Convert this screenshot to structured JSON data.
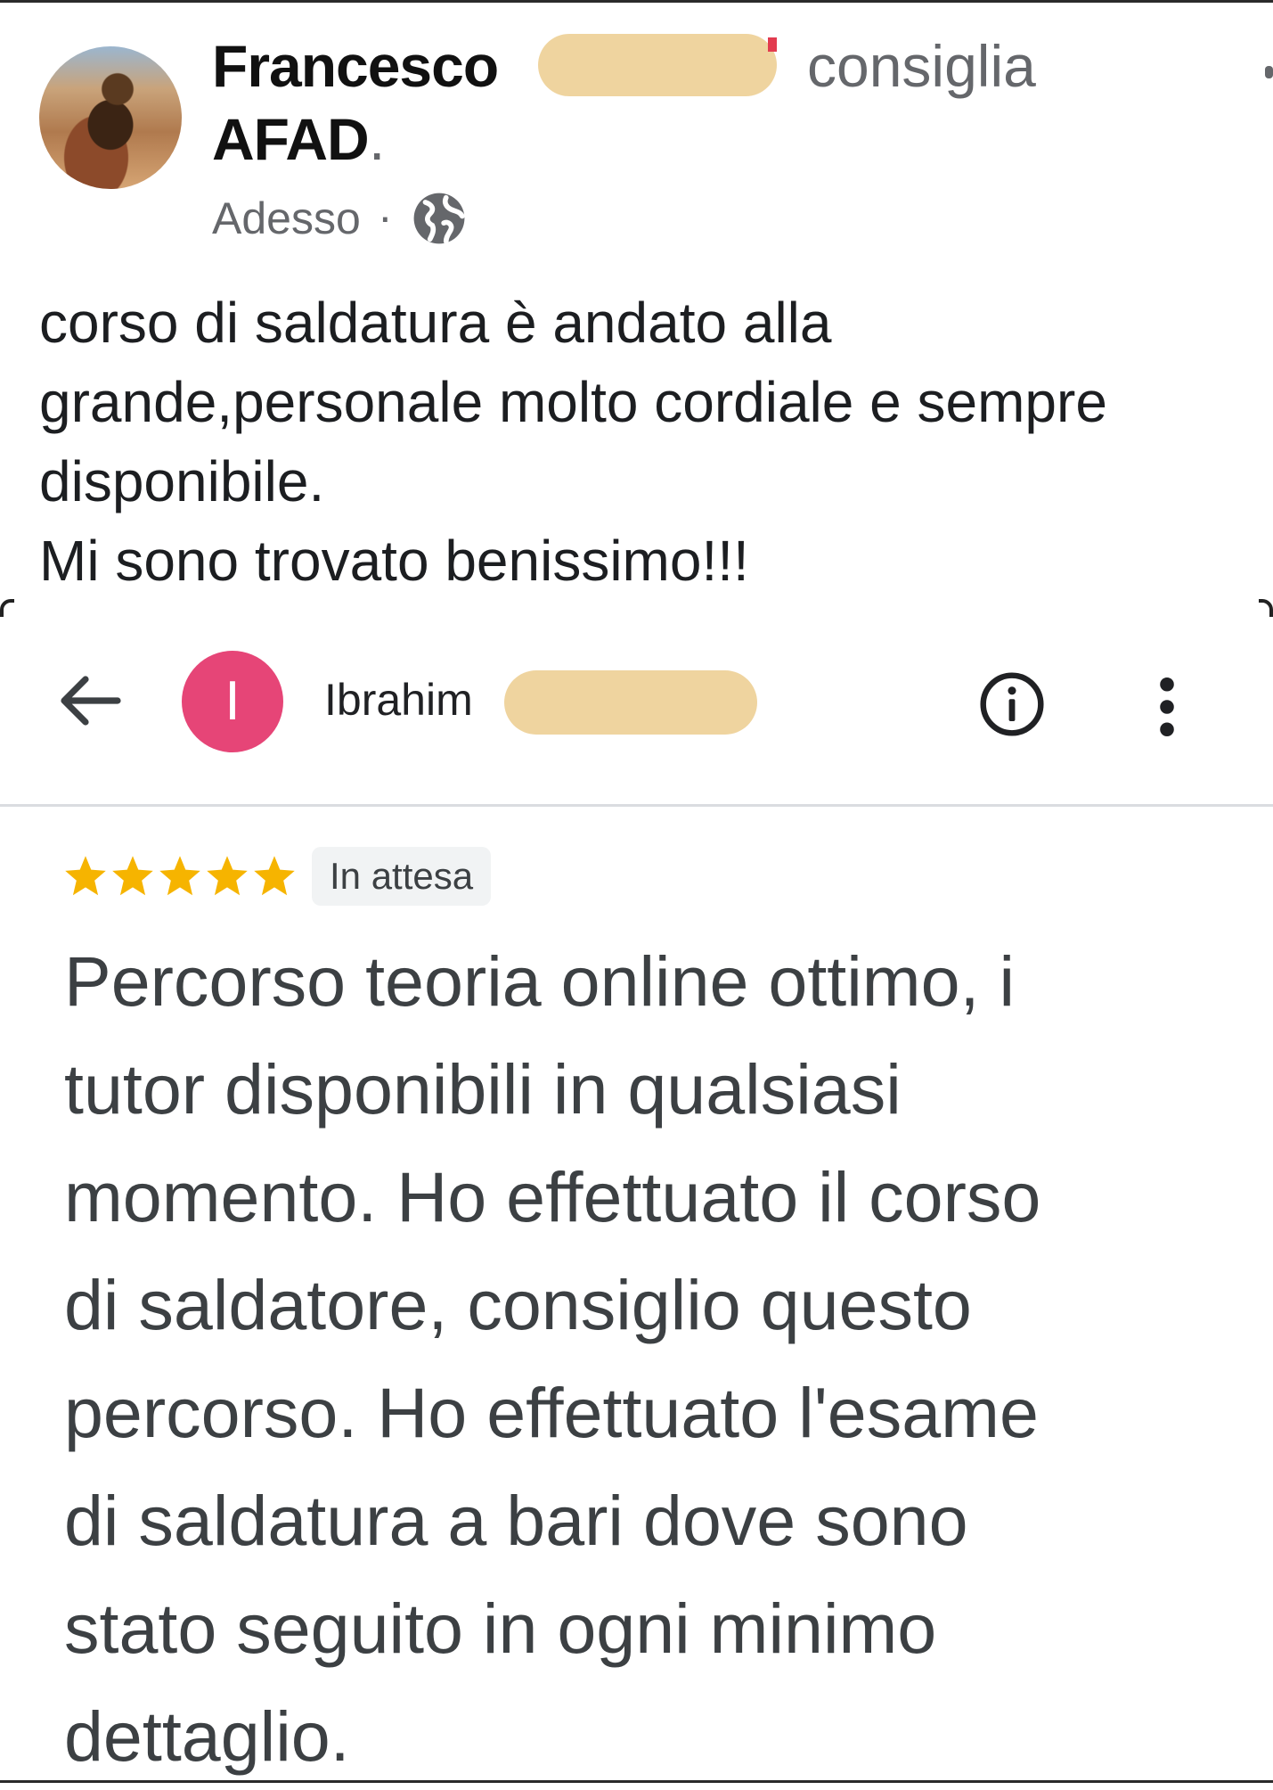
{
  "facebook_post": {
    "author_name": "Francesco",
    "action_text": "consiglia",
    "page_name": "AFAD",
    "page_name_suffix": ".",
    "time": "Adesso",
    "separator": "·",
    "privacy_icon": "globe-icon",
    "text_lines": [
      "corso di saldatura è andato alla",
      "grande,personale molto cordiale e sempre",
      "disponibile.",
      "Mi sono trovato benissimo!!!"
    ]
  },
  "google_review": {
    "header": {
      "back_icon": "arrow-left-icon",
      "avatar_letter": "I",
      "avatar_color": "#e64577",
      "reviewer_name": "Ibrahim",
      "info_icon": "info-icon",
      "menu_icon": "more-vert-icon"
    },
    "rating": 5,
    "star_color": "#f6b400",
    "status_badge": "In attesa",
    "text_lines": [
      "Percorso teoria online ottimo, i",
      "tutor disponibili in qualsiasi",
      "momento. Ho effettuato il corso",
      "di saldatore, consiglio questo",
      "percorso. Ho effettuato l'esame",
      "di saldatura a bari dove sono",
      "stato seguito in ogni minimo",
      "dettaglio."
    ]
  },
  "colors": {
    "redaction": "#efd49f",
    "secondary_text": "#65676b"
  }
}
